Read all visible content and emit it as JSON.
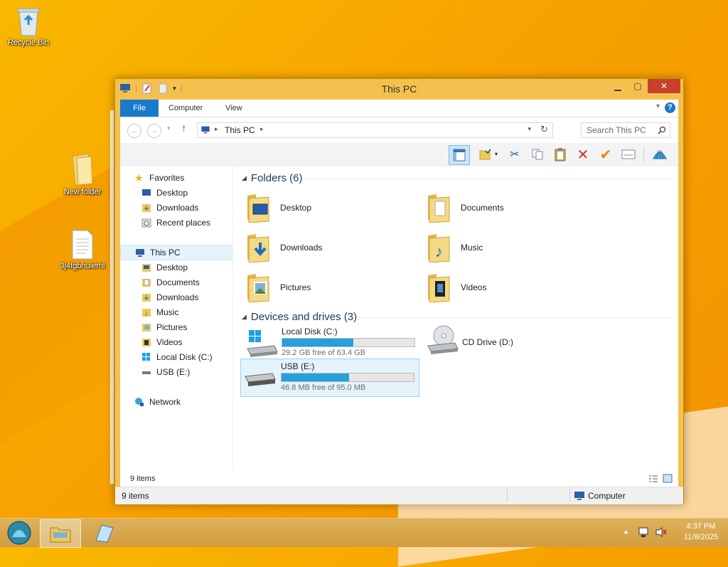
{
  "desktop": {
    "icons": [
      {
        "label": "Recycle Bin",
        "icon": "recycle-bin-icon"
      },
      {
        "label": "New folder",
        "icon": "folder-icon"
      },
      {
        "label": "3j4tgbhuierhi",
        "icon": "text-file-icon"
      }
    ]
  },
  "window": {
    "title": "This PC",
    "ribbon_tabs": [
      "File",
      "Computer",
      "View"
    ],
    "address": {
      "path": "This PC"
    },
    "search": {
      "placeholder": "Search This PC"
    }
  },
  "nav": {
    "favorites": {
      "label": "Favorites",
      "items": [
        "Desktop",
        "Downloads",
        "Recent places"
      ]
    },
    "this_pc": {
      "label": "This PC",
      "items": [
        "Desktop",
        "Documents",
        "Downloads",
        "Music",
        "Pictures",
        "Videos",
        "Local Disk (C:)",
        "USB (E:)"
      ]
    },
    "network": "Network"
  },
  "content": {
    "folders_header": "Folders (6)",
    "folders": [
      "Desktop",
      "Documents",
      "Downloads",
      "Music",
      "Pictures",
      "Videos"
    ],
    "drives_header": "Devices and drives (3)",
    "drives": [
      {
        "name": "Local Disk (C:)",
        "free": "29.2 GB free of 63.4 GB",
        "used_fraction": 0.54
      },
      {
        "name": "CD Drive (D:)"
      },
      {
        "name": "USB (E:)",
        "free": "46.8 MB free of 95.0 MB",
        "used_fraction": 0.51
      }
    ]
  },
  "status": {
    "items_inner": "9 items",
    "items_bar": "9 items",
    "location": "Computer"
  },
  "taskbar": {
    "time": "4:37 PM",
    "date": "11/8/2025"
  },
  "colors": {
    "accent": "#1979ca",
    "progress": "#26a0da",
    "close": "#c7402b"
  }
}
